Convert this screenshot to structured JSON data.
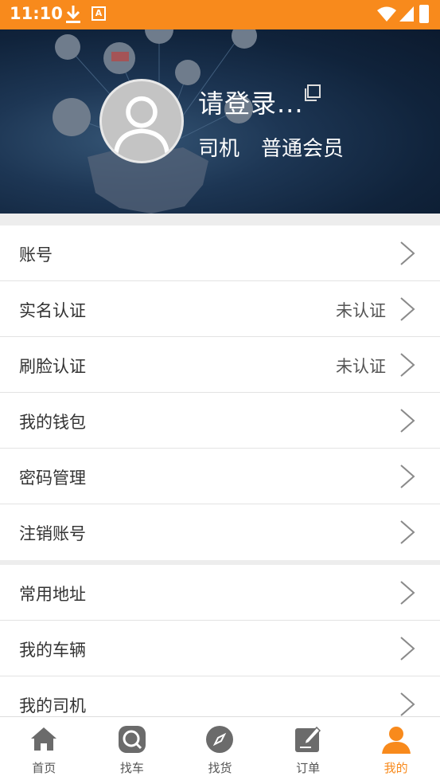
{
  "status_bar": {
    "time": "11:10",
    "app_badge": "A"
  },
  "profile": {
    "login_prompt": "请登录...",
    "role": "司机",
    "member_level": "普通会员"
  },
  "menu_group_1": [
    {
      "label": "账号",
      "value": ""
    },
    {
      "label": "实名认证",
      "value": "未认证"
    },
    {
      "label": "刷脸认证",
      "value": "未认证"
    },
    {
      "label": "我的钱包",
      "value": ""
    },
    {
      "label": "密码管理",
      "value": ""
    },
    {
      "label": "注销账号",
      "value": ""
    }
  ],
  "menu_group_2": [
    {
      "label": "常用地址",
      "value": ""
    },
    {
      "label": "我的车辆",
      "value": ""
    },
    {
      "label": "我的司机",
      "value": ""
    }
  ],
  "bottom_nav": [
    {
      "label": "首页",
      "icon": "home-icon",
      "active": false
    },
    {
      "label": "找车",
      "icon": "search-icon",
      "active": false
    },
    {
      "label": "找货",
      "icon": "compass-icon",
      "active": false
    },
    {
      "label": "订单",
      "icon": "edit-icon",
      "active": false
    },
    {
      "label": "我的",
      "icon": "user-icon",
      "active": true
    }
  ],
  "colors": {
    "accent": "#f88a1c",
    "header_bg": "#10233b",
    "inactive_icon": "#6b6b6b"
  }
}
